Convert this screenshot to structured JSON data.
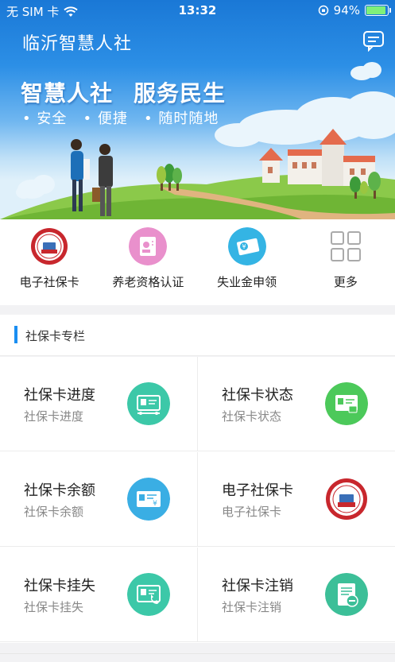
{
  "status_bar": {
    "carrier": "无 SIM 卡",
    "time": "13:32",
    "battery_percent_text": "94%",
    "battery_level": 0.94
  },
  "header": {
    "title": "临沂智慧人社"
  },
  "banner": {
    "slogan_left": "智慧人社",
    "slogan_right": "服务民生",
    "features": [
      "• 安全",
      "• 便捷",
      "• 随时随地"
    ]
  },
  "quick_menu": [
    {
      "label": "电子社保卡",
      "icon": "social-security-card-badge-icon"
    },
    {
      "label": "养老资格认证",
      "icon": "pension-certification-icon"
    },
    {
      "label": "失业金申领",
      "icon": "unemployment-benefit-card-icon"
    },
    {
      "label": "更多",
      "icon": "more-grid-icon"
    }
  ],
  "section": {
    "title": "社保卡专栏"
  },
  "grid": [
    {
      "title": "社保卡进度",
      "subtitle": "社保卡进度",
      "icon": "card-progress-icon",
      "color": "#3cc8a8"
    },
    {
      "title": "社保卡状态",
      "subtitle": "社保卡状态",
      "icon": "card-status-icon",
      "color": "#4cc95a"
    },
    {
      "title": "社保卡余额",
      "subtitle": "社保卡余额",
      "icon": "card-balance-icon",
      "color": "#3aaee4"
    },
    {
      "title": "电子社保卡",
      "subtitle": "电子社保卡",
      "icon": "social-security-card-badge-icon",
      "color": "#c8272d"
    },
    {
      "title": "社保卡挂失",
      "subtitle": "社保卡挂失",
      "icon": "card-report-loss-icon",
      "color": "#3cc8a8"
    },
    {
      "title": "社保卡注销",
      "subtitle": "社保卡注销",
      "icon": "card-cancel-icon",
      "color": "#3cbf98"
    }
  ],
  "colors": {
    "accent": "#1a8ef2",
    "banner_top": "#1a78d6"
  }
}
